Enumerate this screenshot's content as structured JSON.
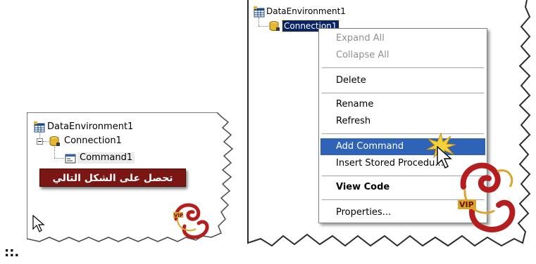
{
  "left_panel": {
    "tree": {
      "root_label": "DataEnvironment1",
      "connection_label": "Connection1",
      "command_label": "Command1"
    },
    "banner_text": "تحصل على الشكل التالي"
  },
  "right_panel": {
    "tree": {
      "root_label": "DataEnvironment1",
      "connection_label": "Connection1"
    },
    "context_menu": {
      "items": [
        {
          "label": "Expand All",
          "state": "disabled"
        },
        {
          "label": "Collapse All",
          "state": "disabled"
        },
        {
          "label": "Delete",
          "state": "normal"
        },
        {
          "label": "Rename",
          "state": "normal"
        },
        {
          "label": "Refresh",
          "state": "normal"
        },
        {
          "label": "Add Command",
          "state": "highlighted"
        },
        {
          "label": "Insert Stored Procedu...",
          "state": "normal"
        },
        {
          "label": "View Code",
          "state": "bold"
        },
        {
          "label": "Properties...",
          "state": "normal"
        }
      ]
    }
  },
  "logos": {
    "badge_text": "VIP"
  },
  "footer_glyph": "::.",
  "colors": {
    "menu_highlight": "#2f63b8",
    "selected_node": "#0a246a",
    "banner_background": "#7a1714",
    "logo_red": "#b51e1e",
    "logo_gold": "#d9a52b"
  },
  "icons": {
    "root": "data-environment-icon",
    "connection": "database-connection-icon",
    "command": "command-icon",
    "cursor": "mouse-pointer-icon"
  }
}
